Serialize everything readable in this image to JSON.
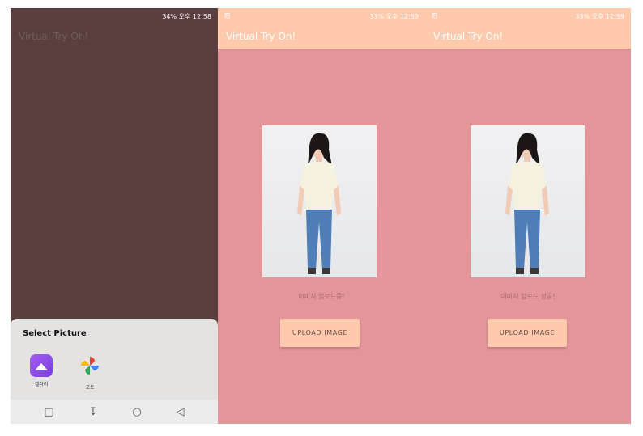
{
  "left_phone": {
    "status_text": "34% 오후 12:58",
    "app_title": "Virtual Try On!",
    "sheet": {
      "title": "Select Picture",
      "apps": [
        {
          "label": "갤러리",
          "icon": "gallery-icon"
        },
        {
          "label": "포토",
          "icon": "photos-pinwheel-icon"
        }
      ]
    },
    "navbar": [
      {
        "icon": "square-icon",
        "glyph": "□"
      },
      {
        "icon": "down-arrow-icon",
        "glyph": "↧"
      },
      {
        "icon": "home-circle-icon",
        "glyph": "○"
      },
      {
        "icon": "back-triangle-icon",
        "glyph": "◁"
      }
    ]
  },
  "middle_phone": {
    "status_left": "⊟",
    "status_text": "33% 오후 12:59",
    "app_title": "Virtual Try On!",
    "message": "이미지 업로드중!",
    "button_label": "UPLOAD IMAGE"
  },
  "right_phone": {
    "status_left": "⊟",
    "status_text": "33% 오후 12:59",
    "app_title": "Virtual Try On!",
    "message": "이미지 업로드 성공!",
    "button_label": "UPLOAD IMAGE"
  },
  "colors": {
    "app_bar": "#fec9ad",
    "screen_bg": "#e49599",
    "dimmed_bg": "#5b3e3e",
    "sheet_bg": "#e5e2e2"
  }
}
